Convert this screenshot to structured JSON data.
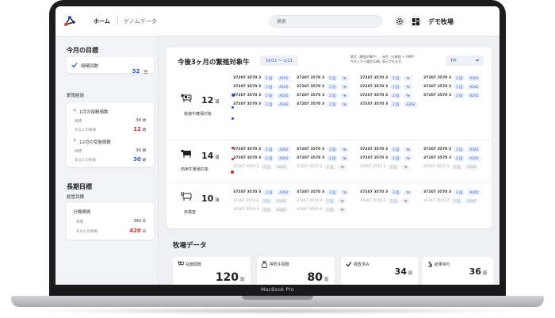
{
  "header": {
    "nav_home": "ホーム",
    "nav_genome": "ゲノムデータ",
    "search_placeholder": "検索",
    "farm_name": "デモ牧場"
  },
  "sidebar": {
    "monthly_goal_title": "今月の目標",
    "monthly_goal_item": {
      "label": "授精回数",
      "value": "32",
      "unit": "回"
    },
    "breeding_label": "繁殖経過",
    "card1": {
      "title": "1月の授精頭数",
      "row1_label": "目標",
      "row1_value": "34",
      "row1_unit": "頭",
      "row2_label": "あなたの牧場",
      "row2_value": "12",
      "row2_unit": "頭"
    },
    "card2": {
      "title": "12月の受胎頭数",
      "row1_label": "目標",
      "row1_value": "34",
      "row1_unit": "頭",
      "row2_label": "あなたの牧場",
      "row2_value": "30",
      "row2_unit": "頭"
    },
    "long_term_title": "長期目標",
    "management_label": "経営目標",
    "card3": {
      "title": "分娩間隔",
      "row1_label": "目標",
      "row1_value": "390",
      "row1_unit": "日",
      "row2_label": "あなたの牧場",
      "row2_value": "420",
      "row2_unit": "日"
    }
  },
  "main": {
    "title": "今後3ヶ月の繁殖対象牛",
    "date_range": "10/11 ～ 1/11",
    "notice_line1": "黒字（繁殖対象牛）、赤色（分娩前 + VWP）",
    "notice_line2": "牛は上から優良な順に表示されます。",
    "sort_select": "TPI",
    "groups": [
      {
        "count": "12",
        "unit": "頭",
        "label": "後継牛確保対象",
        "entries": [
          [
            "37207 3570 3",
            "2 回",
            "A1A1",
            false
          ],
          [
            "37207 3570 3",
            "2 回",
            "",
            false
          ],
          [
            "37207 3570 3",
            "2 回",
            "",
            false
          ],
          [
            "37207 3570 3",
            "2 回",
            "A2A2",
            false
          ],
          [
            "37207 3570 3",
            "2 回",
            "A1A1",
            false
          ],
          [
            "37207 3570 3",
            "2 回",
            "",
            false
          ],
          [
            "37207 3570 3",
            "2 回",
            "",
            false
          ],
          [
            "37207 3570 3",
            "2 回",
            "A2A2",
            false
          ],
          [
            "37207 3570 3",
            "2 回",
            "A1A2",
            false
          ],
          [
            "37207 3570 3",
            "2 回",
            "",
            false
          ],
          [
            "37207 3570 3",
            "2 回",
            "",
            false
          ],
          [
            "37207 3570 3",
            "2 回",
            "A2A2",
            false
          ],
          [
            "37207 3570 3",
            "2 回",
            "A1A2",
            false
          ],
          [
            "37207 3570 3",
            "2 回",
            "",
            false
          ],
          [
            "37207 3570 3",
            "2 回",
            "A2A2",
            false
          ]
        ]
      },
      {
        "count": "14",
        "unit": "頭",
        "label": "肉用牛繁殖対象",
        "entries": [
          [
            "37207 3570 3",
            "2 回",
            "A2A2",
            false
          ],
          [
            "37207 3570 3",
            "2 回",
            "",
            false
          ],
          [
            "37207 3570 3",
            "2 回",
            "",
            false
          ],
          [
            "37207 3570 3",
            "2 回",
            "A2A2",
            false
          ],
          [
            "37207 3570 3",
            "2 回",
            "A2A2",
            false
          ],
          [
            "37207 3570 3",
            "2 回",
            "",
            false
          ],
          [
            "37207 3570 3",
            "2 回",
            "",
            false
          ],
          [
            "37207 3570 3",
            "2 回",
            "A2A2",
            false
          ],
          [
            "37207 3570 3",
            "2 回",
            "A2A2",
            true
          ],
          [
            "37207 3570 3",
            "2 回",
            "",
            true
          ],
          [
            "37207 3570 3",
            "2 回",
            "",
            true
          ],
          [
            "37207 3570 3",
            "2 回",
            "A2A2",
            true
          ]
        ]
      },
      {
        "count": "10",
        "unit": "頭",
        "label": "未検査",
        "entries": [
          [
            "37207 3570 3",
            "2 回",
            "A2A2",
            false
          ],
          [
            "37207 3570 3",
            "2 回",
            "",
            false
          ],
          [
            "37207 3570 3",
            "2 回",
            "",
            false
          ],
          [
            "37207 3570 3",
            "2 回",
            "A2A2",
            false
          ],
          [
            "37207 3570 3",
            "2 回",
            "A2A2",
            true
          ],
          [
            "37207 3570 3",
            "2 回",
            "",
            true
          ],
          [
            "37207 3570 3",
            "2 回",
            "",
            true
          ],
          [
            "37207 3570 3",
            "2 回",
            "A2A2",
            true
          ],
          [
            "37207 3570 3",
            "2 回",
            "A2A2",
            true
          ],
          [
            "37207 3570 3",
            "2 回",
            "",
            true
          ]
        ]
      }
    ]
  },
  "farm_data": {
    "title": "牧場データ",
    "stats": [
      {
        "label": "在籍頭数",
        "value": "120",
        "unit": "頭"
      },
      {
        "label": "搾乳牛頭数",
        "value": "80",
        "unit": "頭"
      },
      {
        "label": "検査済み",
        "value": "34",
        "unit": "頭"
      },
      {
        "label": "結果待ち",
        "value": "36",
        "unit": "頭"
      }
    ]
  },
  "device": {
    "brand": "MacBook Pro"
  },
  "colors": {
    "accent": "#2457c6",
    "alert": "#d32a2a",
    "pill_bg": "#e8efff"
  }
}
